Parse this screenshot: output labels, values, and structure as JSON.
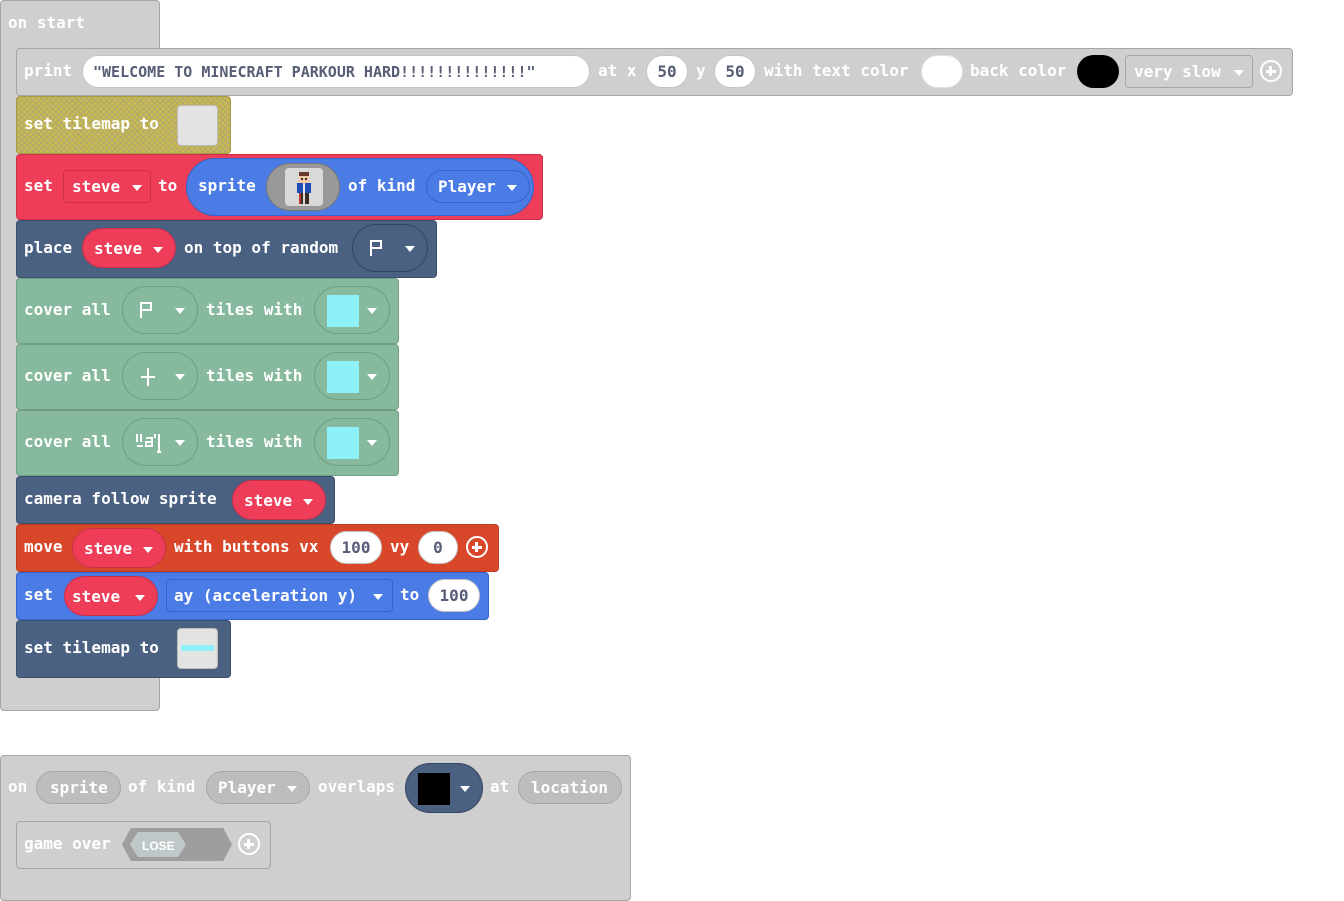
{
  "on_start": {
    "label": "on start",
    "print_block": {
      "keyword": "print",
      "text": "\"WELCOME TO MINECRAFT PARKOUR HARD!!!!!!!!!!!!!!\"",
      "at_x": "at x",
      "x": "50",
      "y_label": "y",
      "y": "50",
      "text_color_label": "with text color",
      "text_color": "#ffffff",
      "back_color_label": "back color",
      "back_color": "#000000",
      "speed": "very slow"
    },
    "set_tilemap_1": {
      "label": "set tilemap to"
    },
    "set_sprite": {
      "set": "set",
      "variable": "steve",
      "to": "to",
      "sprite": "sprite",
      "of_kind": "of kind",
      "kind": "Player"
    },
    "place": {
      "place": "place",
      "variable": "steve",
      "on_top": "on top of random",
      "tile_icon": "flag-tile"
    },
    "cover_rows": [
      {
        "cover": "cover all",
        "tiles_with": "tiles with",
        "tile_icon": "flag-tile",
        "with_color": "#8ef1f9"
      },
      {
        "cover": "cover all",
        "tiles_with": "tiles with",
        "tile_icon": "cross-tile",
        "with_color": "#8ef1f9"
      },
      {
        "cover": "cover all",
        "tiles_with": "tiles with",
        "tile_icon": "text-tile",
        "with_color": "#8ef1f9"
      }
    ],
    "camera": {
      "label": "camera follow sprite",
      "variable": "steve"
    },
    "move": {
      "move": "move",
      "variable": "steve",
      "with_buttons": "with buttons vx",
      "vx": "100",
      "vy_label": "vy",
      "vy": "0"
    },
    "set_accel": {
      "set": "set",
      "variable": "steve",
      "property": "ay (acceleration y)",
      "to": "to",
      "value": "100"
    },
    "set_tilemap_2": {
      "label": "set tilemap to"
    }
  },
  "overlap_event": {
    "on": "on",
    "sprite": "sprite",
    "of_kind": "of kind",
    "kind": "Player",
    "overlaps": "overlaps",
    "tile_color": "#000000",
    "at": "at",
    "location": "location",
    "game_over": "game over",
    "effect": "LOSE"
  }
}
